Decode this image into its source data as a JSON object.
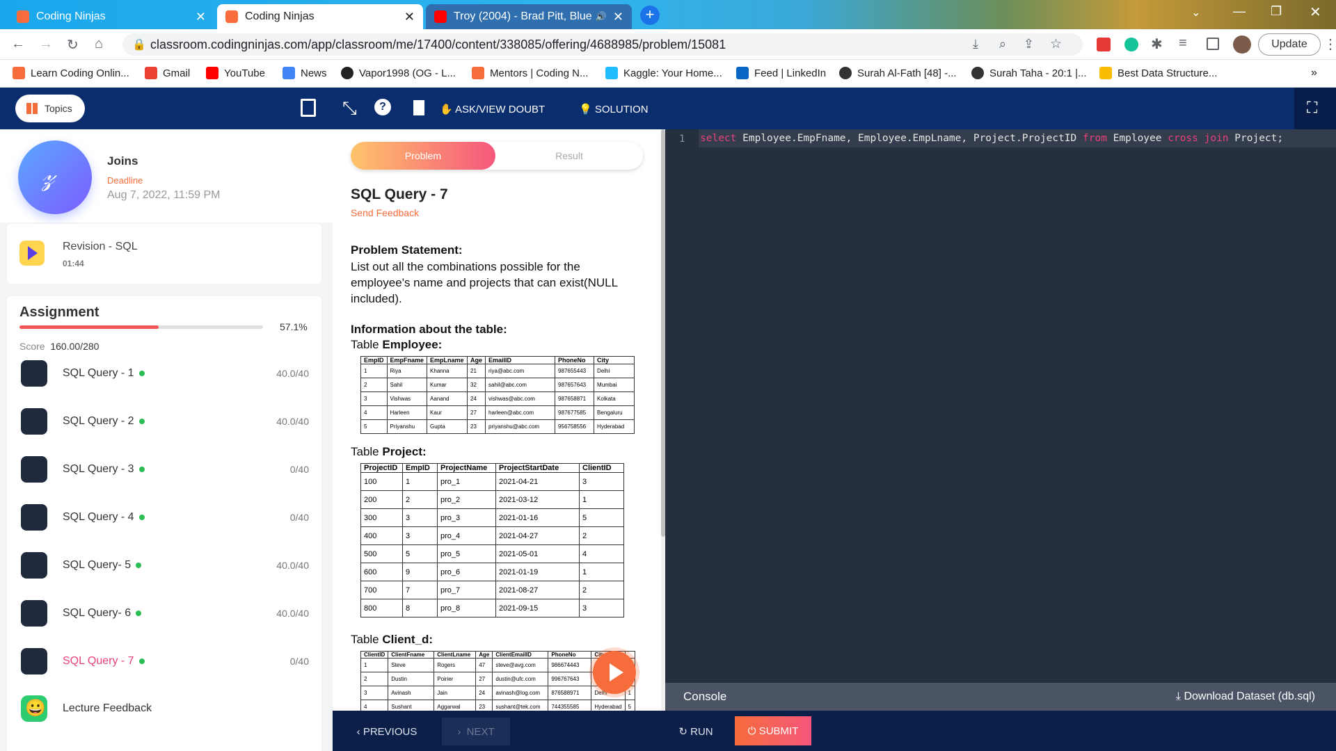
{
  "browser": {
    "tabs": [
      {
        "label": "Coding Ninjas",
        "close": "✕"
      },
      {
        "label": "Coding Ninjas",
        "close": "✕"
      },
      {
        "label": "Troy (2004) - Brad Pitt, Blue",
        "close": "✕"
      }
    ],
    "new_tab": "+",
    "url": "classroom.codingninjas.com/app/classroom/me/17400/content/338085/offering/4688985/problem/15081",
    "update_label": "Update",
    "bookmarks": [
      "Learn Coding Onlin...",
      "Gmail",
      "YouTube",
      "News",
      "Vapor1998 (OG - L...",
      "Mentors | Coding N...",
      "Kaggle: Your Home...",
      "Feed | LinkedIn",
      "Surah Al-Fath [48] -...",
      "Surah Taha - 20:1 |...",
      "Best Data Structure..."
    ],
    "more_bookmarks": "»"
  },
  "topbar": {
    "topics": "Topics",
    "ask_doubt": "ASK/VIEW DOUBT",
    "solution": "SOLUTION"
  },
  "sidebar": {
    "lesson_title": "Joins",
    "deadline_label": "Deadline",
    "deadline": "Aug 7, 2022, 11:59 PM",
    "revision_title": "Revision - SQL",
    "revision_time": "01:44",
    "assignment_title": "Assignment",
    "progress_text": "57.1%",
    "progress": 0.571,
    "score_label": "Score",
    "score": "160.00/280",
    "items": [
      {
        "label": "SQL Query - 1",
        "score": "40.0/40"
      },
      {
        "label": "SQL Query - 2",
        "score": "40.0/40"
      },
      {
        "label": "SQL Query - 3",
        "score": "0/40"
      },
      {
        "label": "SQL Query - 4",
        "score": "0/40"
      },
      {
        "label": "SQL Query- 5",
        "score": "40.0/40"
      },
      {
        "label": "SQL Query- 6",
        "score": "40.0/40"
      },
      {
        "label": "SQL Query - 7",
        "score": "0/40"
      }
    ],
    "feedback": "Lecture Feedback"
  },
  "problem": {
    "tab_problem": "Problem",
    "tab_result": "Result",
    "title": "SQL Query - 7",
    "send_feedback": "Send Feedback",
    "statement_heading": "Problem Statement:",
    "statement": "List out all the combinations possible for the employee's name and projects that can exist(NULL included).",
    "info_heading": "Information about the table:",
    "table_word": "Table",
    "emp_name": "Employee:",
    "proj_name": "Project:",
    "client_name": "Client_d:",
    "employee": {
      "headers": [
        "EmpID",
        "EmpFname",
        "EmpLname",
        "Age",
        "EmailID",
        "PhoneNo",
        "City"
      ],
      "rows": [
        [
          "1",
          "Riya",
          "Khanna",
          "21",
          "riya@abc.com",
          "987655443",
          "Delhi"
        ],
        [
          "2",
          "Sahil",
          "Kumar",
          "32",
          "sahil@abc.com",
          "987657643",
          "Mumbai"
        ],
        [
          "3",
          "Vishwas",
          "Aanand",
          "24",
          "vishwas@abc.com",
          "987658871",
          "Kolkata"
        ],
        [
          "4",
          "Harleen",
          "Kaur",
          "27",
          "harleen@abc.com",
          "987677585",
          "Bengaluru"
        ],
        [
          "5",
          "Priyanshu",
          "Gupta",
          "23",
          "priyanshu@abc.com",
          "956758556",
          "Hyderabad"
        ]
      ]
    },
    "project": {
      "headers": [
        "ProjectID",
        "EmpID",
        "ProjectName",
        "ProjectStartDate",
        "ClientID"
      ],
      "rows": [
        [
          "100",
          "1",
          "pro_1",
          "2021-04-21",
          "3"
        ],
        [
          "200",
          "2",
          "pro_2",
          "2021-03-12",
          "1"
        ],
        [
          "300",
          "3",
          "pro_3",
          "2021-01-16",
          "5"
        ],
        [
          "400",
          "3",
          "pro_4",
          "2021-04-27",
          "2"
        ],
        [
          "500",
          "5",
          "pro_5",
          "2021-05-01",
          "4"
        ],
        [
          "600",
          "9",
          "pro_6",
          "2021-01-19",
          "1"
        ],
        [
          "700",
          "7",
          "pro_7",
          "2021-08-27",
          "2"
        ],
        [
          "800",
          "8",
          "pro_8",
          "2021-09-15",
          "3"
        ]
      ]
    },
    "client": {
      "headers": [
        "ClientID",
        "ClientFname",
        "ClientLname",
        "Age",
        "ClientEmailID",
        "PhoneNo",
        "City",
        ""
      ],
      "rows": [
        [
          "1",
          "Steve",
          "Rogers",
          "47",
          "steve@avg.com",
          "986674443",
          "Kolkata",
          "3"
        ],
        [
          "2",
          "Dustin",
          "Poirier",
          "27",
          "dustin@ufc.com",
          "996767643",
          "Kolkata",
          "2"
        ],
        [
          "3",
          "Avinash",
          "Jain",
          "24",
          "avinash@log.com",
          "876588971",
          "Delhi",
          "1"
        ],
        [
          "4",
          "Sushant",
          "Aggarwal",
          "23",
          "sushant@tek.com",
          "744355585",
          "Hyderabad",
          "5"
        ]
      ]
    }
  },
  "editor": {
    "line_number": "1",
    "code": [
      {
        "t": "select",
        "k": true
      },
      {
        "t": " Employee.EmpFname, Employee.EmpLname, Project.ProjectID ",
        "k": false
      },
      {
        "t": "from",
        "k": true
      },
      {
        "t": " Employee ",
        "k": false
      },
      {
        "t": "cross join",
        "k": true
      },
      {
        "t": " Project;",
        "k": false
      }
    ]
  },
  "console": {
    "label": "Console",
    "download": "Download Dataset (db.sql)"
  },
  "footer": {
    "previous": "PREVIOUS",
    "next": "NEXT",
    "run": "RUN",
    "submit": "SUBMIT"
  },
  "colors": {
    "brand_navy": "#0a2d6e",
    "accent_orange": "#f66c3b",
    "active_red": "#e8407a",
    "done_green": "#2bbd55",
    "progress_red": "#f05454"
  }
}
